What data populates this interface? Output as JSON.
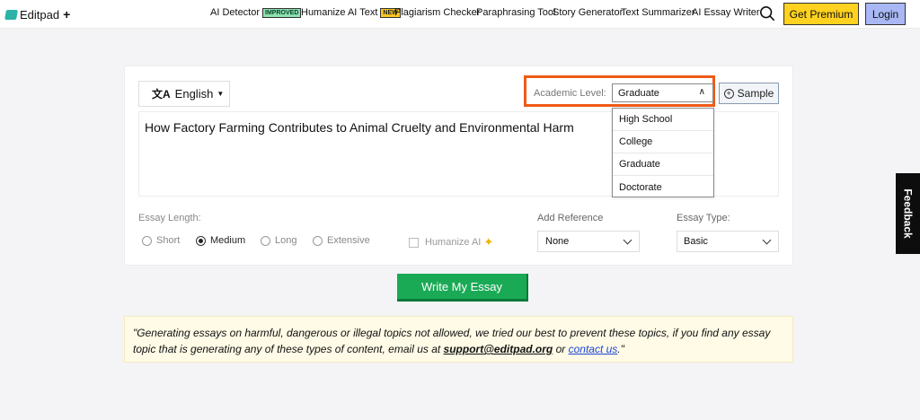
{
  "header": {
    "logo": "Editpad",
    "nav": [
      {
        "label": "AI Detector",
        "badge": "IMPROVED"
      },
      {
        "label": "Humanize AI Text",
        "badge": "NEW"
      },
      {
        "label": "Plagiarism Checker"
      },
      {
        "label": "Paraphrasing Tool"
      },
      {
        "label": "Story Generator"
      },
      {
        "label": "Text Summarizer"
      },
      {
        "label": "AI Essay Writer"
      }
    ],
    "premium_label": "Get Premium",
    "login_label": "Login"
  },
  "editor": {
    "language": "English",
    "academic_level_label": "Academic Level:",
    "academic_level_value": "Graduate",
    "academic_level_options": [
      "High School",
      "College",
      "Graduate",
      "Doctorate"
    ],
    "sample_label": "Sample",
    "topic": "How Factory Farming Contributes to Animal Cruelty and Environmental Harm",
    "essay_length_label": "Essay Length:",
    "length_options": [
      "Short",
      "Medium",
      "Long",
      "Extensive"
    ],
    "length_selected": "Medium",
    "humanize_label": "Humanize AI",
    "add_reference_label": "Add Reference",
    "add_reference_value": "None",
    "essay_type_label": "Essay Type:",
    "essay_type_value": "Basic"
  },
  "write_button": "Write My Essay",
  "notice": {
    "text_before": "\"Generating essays on harmful, dangerous or illegal topics not allowed, we tried our best to prevent these topics, if you find any essay topic that is generating any of these types of content, email us at ",
    "email": "support@editpad.org",
    "text_middle": " or ",
    "contact": "contact us",
    "text_after": ".\""
  },
  "feedback_label": "Feedback",
  "colors": {
    "premium": "#ffd21f",
    "login": "#a9b8f5",
    "write_button": "#1aaa56",
    "highlight": "#ee5a16",
    "notice_bg": "#fffbe6"
  }
}
